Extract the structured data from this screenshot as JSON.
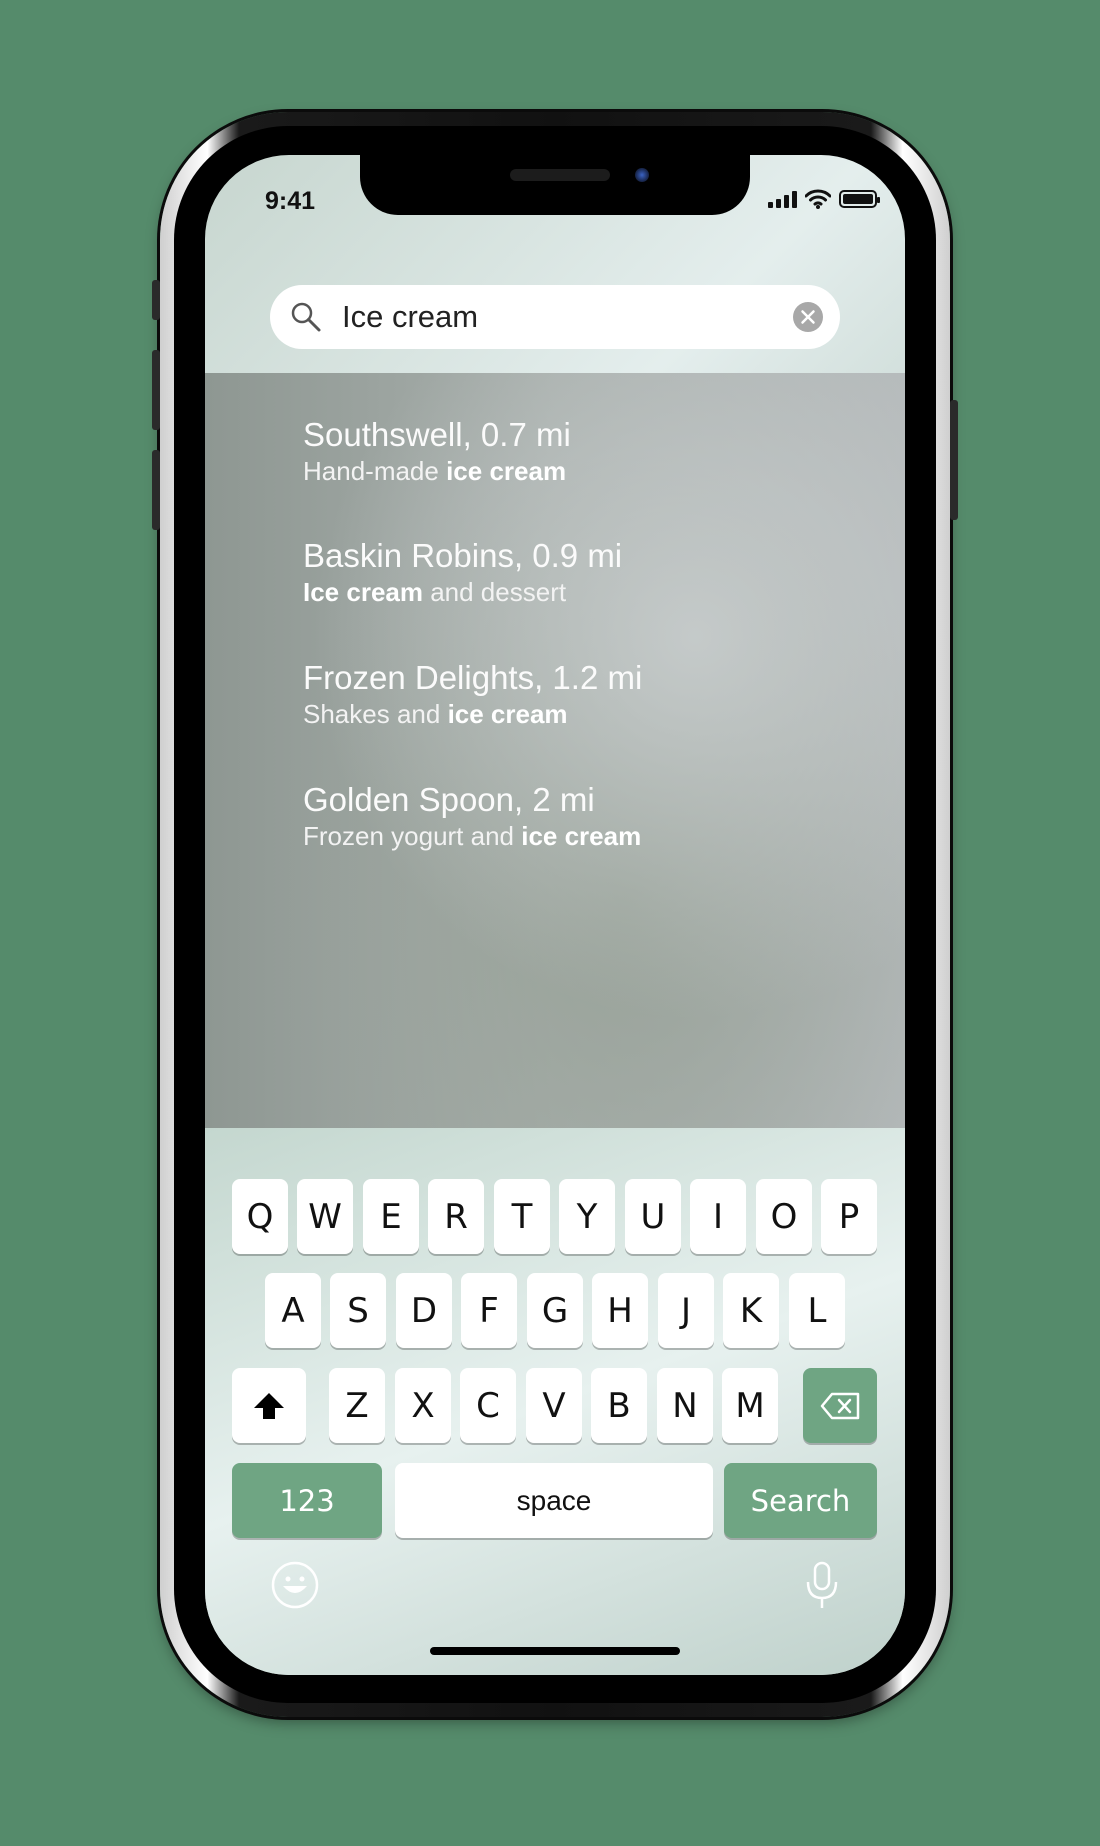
{
  "status_bar": {
    "time": "9:41",
    "icons": [
      "cellular-signal-icon",
      "wifi-icon",
      "battery-icon"
    ]
  },
  "search": {
    "query": "Ice cream",
    "icons": [
      "search-icon",
      "clear-icon"
    ]
  },
  "results": [
    {
      "title": "Southswell, 0.7 mi",
      "sub_pre": "Hand-made ",
      "sub_bold": "ice cream",
      "sub_post": ""
    },
    {
      "title": "Baskin Robins, 0.9 mi",
      "sub_pre": "",
      "sub_bold": "Ice cream",
      "sub_post": " and dessert"
    },
    {
      "title": "Frozen Delights, 1.2 mi",
      "sub_pre": "Shakes and ",
      "sub_bold": "ice cream",
      "sub_post": ""
    },
    {
      "title": "Golden Spoon, 2 mi",
      "sub_pre": "Frozen yogurt and ",
      "sub_bold": "ice cream",
      "sub_post": ""
    }
  ],
  "keyboard": {
    "row1": [
      "Q",
      "W",
      "E",
      "R",
      "T",
      "Y",
      "U",
      "I",
      "O",
      "P"
    ],
    "row2": [
      "A",
      "S",
      "D",
      "F",
      "G",
      "H",
      "J",
      "K",
      "L"
    ],
    "row3": [
      "Z",
      "X",
      "C",
      "V",
      "B",
      "N",
      "M"
    ],
    "numbers_label": "123",
    "space_label": "space",
    "search_label": "Search",
    "icons": [
      "shift-icon",
      "backspace-icon",
      "emoji-icon",
      "microphone-icon"
    ]
  },
  "colors": {
    "background": "#558b6b",
    "key_accent": "#6fa583"
  }
}
